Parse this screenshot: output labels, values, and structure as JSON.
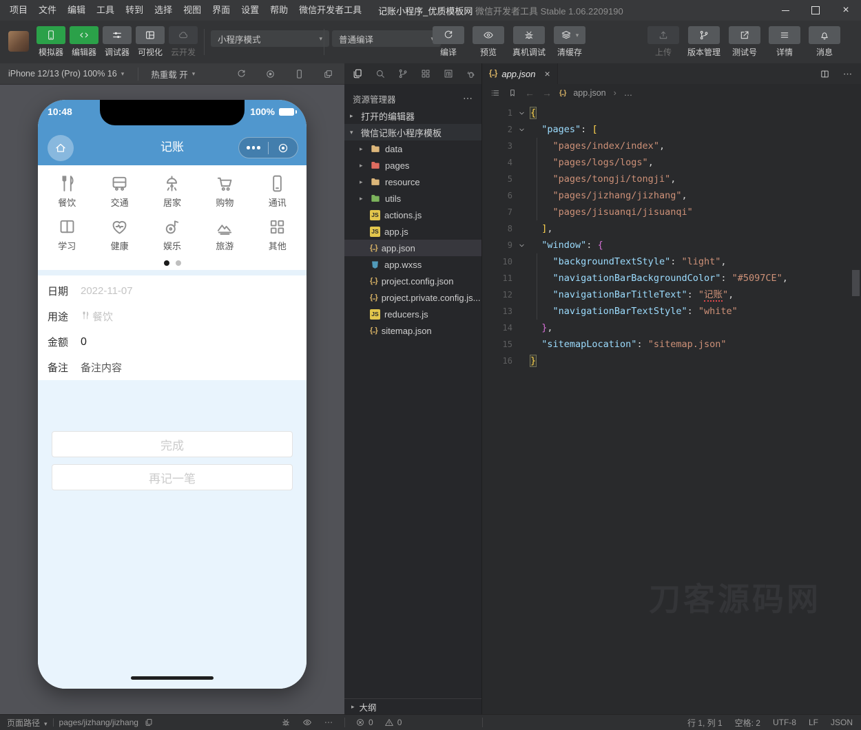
{
  "colors": {
    "accent_green": "#2ba149",
    "nav_blue": "#5097CE",
    "selection_row": "#37373d"
  },
  "titlebar": {
    "menus": [
      "项目",
      "文件",
      "编辑",
      "工具",
      "转到",
      "选择",
      "视图",
      "界面",
      "设置",
      "帮助",
      "微信开发者工具"
    ],
    "project_title": "记账小程序_优质模板网",
    "app_name": "微信开发者工具",
    "version": "Stable 1.06.2209190"
  },
  "toolbar": {
    "toggles": [
      {
        "label": "模拟器",
        "icon": "simulator-phone-icon",
        "state": "active"
      },
      {
        "label": "编辑器",
        "icon": "code-icon",
        "state": "active"
      },
      {
        "label": "调试器",
        "icon": "sliders-icon",
        "state": "inactive"
      },
      {
        "label": "可视化",
        "icon": "layout-icon",
        "state": "inactive"
      },
      {
        "label": "云开发",
        "icon": "cloud-icon",
        "state": "disabled"
      }
    ],
    "mode_select": "小程序模式",
    "compile_select": "普通编译",
    "actions": [
      {
        "label": "编译",
        "icon": "refresh-icon"
      },
      {
        "label": "预览",
        "icon": "eye-icon"
      },
      {
        "label": "真机调试",
        "icon": "bug-icon"
      },
      {
        "label": "清缓存",
        "icon": "layers-icon",
        "caret": true
      }
    ],
    "right_actions": [
      {
        "label": "上传",
        "icon": "upload-icon",
        "disabled": true
      },
      {
        "label": "版本管理",
        "icon": "git-branch-icon"
      },
      {
        "label": "测试号",
        "icon": "external-link-icon"
      },
      {
        "label": "详情",
        "icon": "menu-lines-icon"
      },
      {
        "label": "消息",
        "icon": "bell-icon"
      }
    ]
  },
  "simulator": {
    "device_label": "iPhone 12/13 (Pro) 100% 16",
    "hot_reload_label": "热重载 开",
    "bar_icons": [
      "refresh-icon",
      "record-icon",
      "phone-outline-icon",
      "windows-icon"
    ],
    "phone": {
      "status_time": "10:48",
      "battery_percent": "100%",
      "nav_title": "记账",
      "categories": [
        {
          "label": "餐饮",
          "icon": "utensils-icon"
        },
        {
          "label": "交通",
          "icon": "bus-icon"
        },
        {
          "label": "居家",
          "icon": "lamp-icon"
        },
        {
          "label": "购物",
          "icon": "cart-icon"
        },
        {
          "label": "通讯",
          "icon": "mobile-icon"
        },
        {
          "label": "学习",
          "icon": "book-icon"
        },
        {
          "label": "健康",
          "icon": "health-icon"
        },
        {
          "label": "娱乐",
          "icon": "entertainment-icon"
        },
        {
          "label": "旅游",
          "icon": "travel-icon"
        },
        {
          "label": "其他",
          "icon": "grid-icon"
        }
      ],
      "form": [
        {
          "label": "日期",
          "value": "2022-11-07",
          "tone": "muted"
        },
        {
          "label": "用途",
          "value": "餐饮",
          "tone": "muted",
          "value_icon": "utensils-icon"
        },
        {
          "label": "金额",
          "value": "0",
          "tone": "dark"
        },
        {
          "label": "备注",
          "value": "备注内容",
          "tone": "mid"
        }
      ],
      "buttons": [
        "完成",
        "再记一笔"
      ]
    }
  },
  "explorer": {
    "activity_icons": [
      "files-icon",
      "search-icon",
      "git-branch-icon",
      "blocks-icon",
      "package-icon",
      "kettle-icon"
    ],
    "header": "资源管理器",
    "sections": [
      {
        "label": "打开的编辑器"
      },
      {
        "label": "微信记账小程序模板"
      }
    ],
    "tree": [
      {
        "label": "data",
        "icon": "folder",
        "color": "#dcb67a",
        "expandable": true
      },
      {
        "label": "pages",
        "icon": "folder",
        "color": "#e06c60",
        "expandable": true
      },
      {
        "label": "resource",
        "icon": "folder",
        "color": "#dcb67a",
        "expandable": true
      },
      {
        "label": "utils",
        "icon": "folder",
        "color": "#7cb35c",
        "expandable": true
      },
      {
        "label": "actions.js",
        "icon": "js"
      },
      {
        "label": "app.js",
        "icon": "js"
      },
      {
        "label": "app.json",
        "icon": "json",
        "selected": true
      },
      {
        "label": "app.wxss",
        "icon": "wxss"
      },
      {
        "label": "project.config.json",
        "icon": "json"
      },
      {
        "label": "project.private.config.js...",
        "icon": "json"
      },
      {
        "label": "reducers.js",
        "icon": "js"
      },
      {
        "label": "sitemap.json",
        "icon": "json"
      }
    ],
    "outline_label": "大纲"
  },
  "editor": {
    "tab_label": "app.json",
    "breadcrumb_file": "app.json",
    "breadcrumb_more": "…",
    "watermark": "刀客源码网",
    "code_lines": [
      {
        "n": 1,
        "f": true,
        "segs": [
          [
            "{",
            "bx"
          ]
        ]
      },
      {
        "n": 2,
        "f": true,
        "segs": [
          [
            "  ",
            "p"
          ],
          [
            "\"pages\"",
            "k"
          ],
          [
            ": ",
            "p"
          ],
          [
            "[",
            "bg"
          ]
        ]
      },
      {
        "n": 3,
        "g": true,
        "segs": [
          [
            "    ",
            "p"
          ],
          [
            "\"pages/index/index\"",
            "s"
          ],
          [
            ",",
            "p"
          ]
        ]
      },
      {
        "n": 4,
        "g": true,
        "segs": [
          [
            "    ",
            "p"
          ],
          [
            "\"pages/logs/logs\"",
            "s"
          ],
          [
            ",",
            "p"
          ]
        ]
      },
      {
        "n": 5,
        "g": true,
        "segs": [
          [
            "    ",
            "p"
          ],
          [
            "\"pages/tongji/tongji\"",
            "s"
          ],
          [
            ",",
            "p"
          ]
        ]
      },
      {
        "n": 6,
        "g": true,
        "segs": [
          [
            "    ",
            "p"
          ],
          [
            "\"pages/jizhang/jizhang\"",
            "s"
          ],
          [
            ",",
            "p"
          ]
        ]
      },
      {
        "n": 7,
        "g": true,
        "segs": [
          [
            "    ",
            "p"
          ],
          [
            "\"pages/jisuanqi/jisuanqi\"",
            "s"
          ]
        ]
      },
      {
        "n": 8,
        "segs": [
          [
            "  ",
            "p"
          ],
          [
            "]",
            "bg"
          ],
          [
            ",",
            "p"
          ]
        ]
      },
      {
        "n": 9,
        "f": true,
        "segs": [
          [
            "  ",
            "p"
          ],
          [
            "\"window\"",
            "k"
          ],
          [
            ": ",
            "p"
          ],
          [
            "{",
            "bp"
          ]
        ]
      },
      {
        "n": 10,
        "g": true,
        "segs": [
          [
            "    ",
            "p"
          ],
          [
            "\"backgroundTextStyle\"",
            "k"
          ],
          [
            ": ",
            "p"
          ],
          [
            "\"light\"",
            "s"
          ],
          [
            ",",
            "p"
          ]
        ]
      },
      {
        "n": 11,
        "g": true,
        "segs": [
          [
            "    ",
            "p"
          ],
          [
            "\"navigationBarBackgroundColor\"",
            "k"
          ],
          [
            ": ",
            "p"
          ],
          [
            "\"#5097CE\"",
            "s"
          ],
          [
            ",",
            "p"
          ]
        ]
      },
      {
        "n": 12,
        "g": true,
        "segs": [
          [
            "    ",
            "p"
          ],
          [
            "\"navigationBarTitleText\"",
            "k"
          ],
          [
            ": ",
            "p"
          ],
          [
            "\"",
            "s"
          ],
          [
            "记账",
            "s w"
          ],
          [
            "\"",
            "s"
          ],
          [
            ",",
            "p"
          ]
        ]
      },
      {
        "n": 13,
        "g": true,
        "segs": [
          [
            "    ",
            "p"
          ],
          [
            "\"navigationBarTextStyle\"",
            "k"
          ],
          [
            ": ",
            "p"
          ],
          [
            "\"white\"",
            "s"
          ]
        ]
      },
      {
        "n": 14,
        "segs": [
          [
            "  ",
            "p"
          ],
          [
            "}",
            "bp"
          ],
          [
            ",",
            "p"
          ]
        ]
      },
      {
        "n": 15,
        "segs": [
          [
            "  ",
            "p"
          ],
          [
            "\"sitemapLocation\"",
            "k"
          ],
          [
            ": ",
            "p"
          ],
          [
            "\"sitemap.json\"",
            "s"
          ]
        ]
      },
      {
        "n": 16,
        "segs": [
          [
            "}",
            "bx"
          ]
        ]
      }
    ]
  },
  "statusbar": {
    "path_label": "页面路径",
    "page_path": "pages/jizhang/jizhang",
    "errors": "0",
    "warnings": "0",
    "right": [
      "行 1, 列 1",
      "空格: 2",
      "UTF-8",
      "LF",
      "JSON"
    ]
  }
}
